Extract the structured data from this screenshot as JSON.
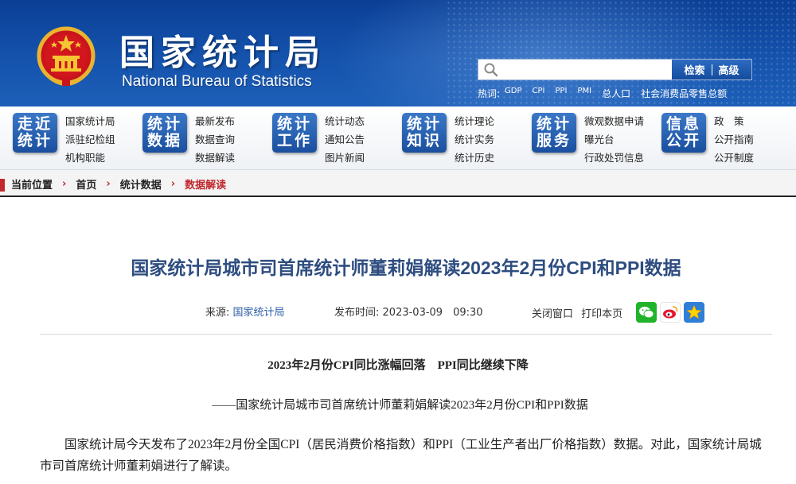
{
  "header": {
    "title_cn": "国家统计局",
    "title_en": "National Bureau of Statistics",
    "search": {
      "placeholder": "",
      "search_label": "检索",
      "advanced_label": "高级"
    },
    "hotwords_label": "热词:",
    "hotwords": [
      "GDP",
      "CPI",
      "PPI",
      "PMI",
      "总人口",
      "社会消费品零售总额"
    ]
  },
  "nav": [
    {
      "badge_line1": "走近",
      "badge_line2": "统计",
      "links": [
        "国家统计局",
        "派驻纪检组",
        "机构职能"
      ]
    },
    {
      "badge_line1": "统计",
      "badge_line2": "数据",
      "links": [
        "最新发布",
        "数据查询",
        "数据解读"
      ]
    },
    {
      "badge_line1": "统计",
      "badge_line2": "工作",
      "links": [
        "统计动态",
        "通知公告",
        "图片新闻"
      ]
    },
    {
      "badge_line1": "统计",
      "badge_line2": "知识",
      "links": [
        "统计理论",
        "统计实务",
        "统计历史"
      ]
    },
    {
      "badge_line1": "统计",
      "badge_line2": "服务",
      "links": [
        "微观数据申请",
        "曝光台",
        "行政处罚信息"
      ]
    },
    {
      "badge_line1": "信息",
      "badge_line2": "公开",
      "links": [
        "政　策",
        "公开指南",
        "公开制度"
      ]
    }
  ],
  "breadcrumb": {
    "label": "当前位置",
    "items": [
      "首页",
      "统计数据",
      "数据解读"
    ],
    "arrow": "›"
  },
  "article": {
    "title": "国家统计局城市司首席统计师董莉娟解读2023年2月份CPI和PPI数据",
    "source_label": "来源:",
    "source": "国家统计局",
    "time_label": "发布时间:",
    "time": "2023-03-09　09:30",
    "close_window": "关闭窗口",
    "print_page": "打印本页",
    "share_icons": [
      "wechat-icon",
      "weibo-icon",
      "favorite-icon"
    ],
    "subtitle": "2023年2月份CPI同比涨幅回落　PPI同比继续下降",
    "caption": "——国家统计局城市司首席统计师董莉娟解读2023年2月份CPI和PPI数据",
    "paragraph": "国家统计局今天发布了2023年2月份全国CPI（居民消费价格指数）和PPI（工业生产者出厂价格指数）数据。对此，国家统计局城市司首席统计师董莉娟进行了解读。"
  },
  "colors": {
    "header_blue": "#1553ad",
    "nav_badge_blue": "#1a4f9e",
    "title_blue": "#2e4d80",
    "accent_red": "#c0282d",
    "link_blue": "#2b5ea8"
  }
}
